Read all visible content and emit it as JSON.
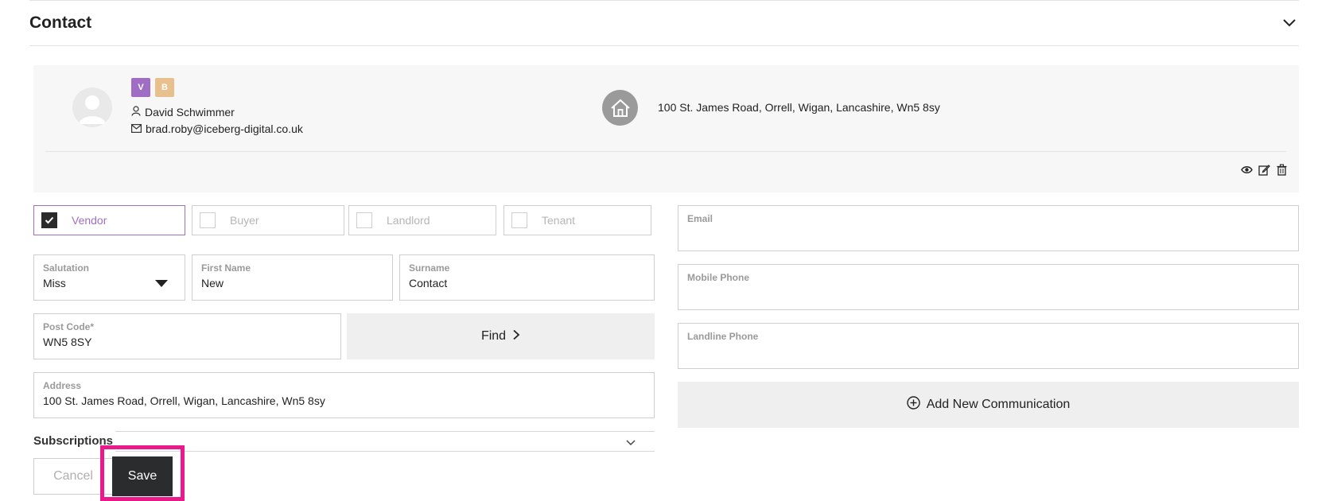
{
  "section": {
    "title": "Contact"
  },
  "card": {
    "badges": [
      "V",
      "B"
    ],
    "name": "David Schwimmer",
    "email": "brad.roby@iceberg-digital.co.uk",
    "address": "100 St. James Road, Orrell, Wigan, Lancashire, Wn5 8sy"
  },
  "roles": [
    {
      "label": "Vendor",
      "checked": true
    },
    {
      "label": "Buyer",
      "checked": false
    },
    {
      "label": "Landlord",
      "checked": false
    },
    {
      "label": "Tenant",
      "checked": false
    }
  ],
  "form": {
    "salutation": {
      "label": "Salutation",
      "value": "Miss"
    },
    "first_name": {
      "label": "First Name",
      "value": "New"
    },
    "surname": {
      "label": "Surname",
      "value": "Contact"
    },
    "post_code": {
      "label": "Post Code*",
      "value": "WN5 8SY"
    },
    "find_label": "Find",
    "address": {
      "label": "Address",
      "value": "100 St. James Road, Orrell, Wigan, Lancashire, Wn5 8sy"
    },
    "email": {
      "label": "Email",
      "value": ""
    },
    "mobile": {
      "label": "Mobile Phone",
      "value": ""
    },
    "landline": {
      "label": "Landline Phone",
      "value": ""
    },
    "add_communication": "Add New Communication"
  },
  "subscriptions": {
    "label": "Subscriptions"
  },
  "actions": {
    "cancel": "Cancel",
    "save": "Save"
  },
  "colors": {
    "accent": "#9f6fc4",
    "highlight": "#ea1a8c",
    "dark_button": "#2a2c2e"
  }
}
